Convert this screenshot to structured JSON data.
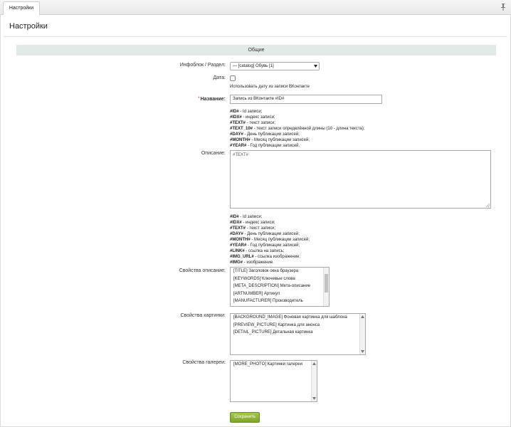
{
  "tab": {
    "label": "Настройки"
  },
  "page": {
    "title": "Настройки"
  },
  "section": {
    "title": "Общие"
  },
  "form": {
    "iblock": {
      "label": "Инфоблок / Раздел:",
      "value": "— [catalog] Обувь [1]"
    },
    "date": {
      "label": "Дата:",
      "checked": false,
      "note": "Использовать дату из записи ВКонтакте"
    },
    "name": {
      "required_mark": "*",
      "label": "Название:",
      "value": "Запись из ВКонтакте #ID#"
    },
    "name_hints": [
      {
        "code": "#ID#",
        "text": " - Id записи;"
      },
      {
        "code": "#IDX#",
        "text": " - индекс записи;"
      },
      {
        "code": "#TEXT#",
        "text": " - текст записи;"
      },
      {
        "code": "#TEXT_10#",
        "text": " - текст записи определённой длины (10 - длина текста);"
      },
      {
        "code": "#DAY#",
        "text": " - День публикации записей;"
      },
      {
        "code": "#MONTH#",
        "text": " - Месяц публикации записей;"
      },
      {
        "code": "#YEAR#",
        "text": " - Год публикации записей."
      }
    ],
    "description": {
      "label": "Описание:",
      "value": "#TEXT#"
    },
    "description_hints": [
      {
        "code": "#ID#",
        "text": " - Id записи;"
      },
      {
        "code": "#IDX#",
        "text": " - индекс записи;"
      },
      {
        "code": "#TEXT#",
        "text": " - текст записи;"
      },
      {
        "code": "#DAY#",
        "text": " - День публикации записей;"
      },
      {
        "code": "#MONTH#",
        "text": " - Месяц публикации записей;"
      },
      {
        "code": "#YEAR#",
        "text": " - Год публикации записей;"
      },
      {
        "code": "#LINK#",
        "text": " - ссылка на запись;"
      },
      {
        "code": "#IMG_URL#",
        "text": " - ссылка изображение;"
      },
      {
        "code": "#IMG#",
        "text": " - изображение."
      }
    ],
    "desc_props": {
      "label": "Свойства описание:",
      "options": [
        "[TITLE] Заголовок окна браузера",
        "[KEYWORDS] Ключевые слова",
        "[META_DESCRIPTION] Мета-описание",
        "[ARTNUMBER] Артикул",
        "[MANUFACTURER] Производитель"
      ]
    },
    "picture_props": {
      "label": "Свойства картинки:",
      "options": [
        "[BACKGROUND_IMAGE] Фоновая картинка для шаблона",
        "[PREVIEW_PICTURE] Картинка для анонса",
        "[DETAIL_PICTURE] Детальная картинка"
      ]
    },
    "gallery_props": {
      "label": "Свойства галереи:",
      "options": [
        "[MORE_PHOTO] Картинки галереи"
      ]
    }
  },
  "save_button": {
    "label": "Сохранить"
  },
  "colors": {
    "section_bg": "#e2eae8",
    "button_green": "#8db43a",
    "required": "#dd0000"
  }
}
